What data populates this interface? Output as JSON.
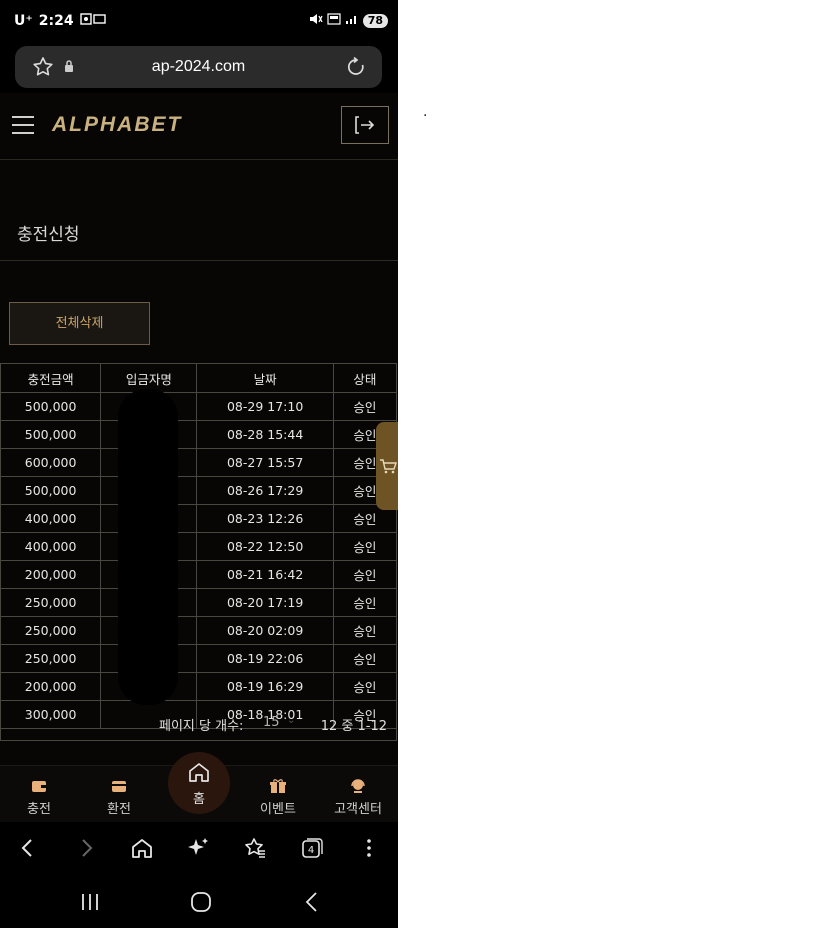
{
  "status_bar": {
    "carrier": "U⁺",
    "time": "2:24",
    "battery": "78"
  },
  "browser": {
    "url": "ap-2024.com",
    "tab_count": "4"
  },
  "site": {
    "logo": "ALPHABET",
    "page_title": "충전신청",
    "delete_all_label": "전체삭제"
  },
  "table": {
    "headers": [
      "충전금액",
      "입금자명",
      "날짜",
      "상태"
    ],
    "rows": [
      {
        "amount": "500,000",
        "name": "",
        "date": "08-29 17:10",
        "status": "승인"
      },
      {
        "amount": "500,000",
        "name": "",
        "date": "08-28 15:44",
        "status": "승인"
      },
      {
        "amount": "600,000",
        "name": "",
        "date": "08-27 15:57",
        "status": "승인"
      },
      {
        "amount": "500,000",
        "name": "",
        "date": "08-26 17:29",
        "status": "승인"
      },
      {
        "amount": "400,000",
        "name": "",
        "date": "08-23 12:26",
        "status": "승인"
      },
      {
        "amount": "400,000",
        "name": "",
        "date": "08-22 12:50",
        "status": "승인"
      },
      {
        "amount": "200,000",
        "name": "",
        "date": "08-21 16:42",
        "status": "승인"
      },
      {
        "amount": "250,000",
        "name": "",
        "date": "08-20 17:19",
        "status": "승인"
      },
      {
        "amount": "250,000",
        "name": "",
        "date": "08-20 02:09",
        "status": "승인"
      },
      {
        "amount": "250,000",
        "name": "",
        "date": "08-19 22:06",
        "status": "승인"
      },
      {
        "amount": "200,000",
        "name": "",
        "date": "08-19 16:29",
        "status": "승인"
      },
      {
        "amount": "300,000",
        "name": "",
        "date": "08-18 18:01",
        "status": "승인"
      }
    ]
  },
  "pager": {
    "per_page_label": "페이지 당 개수:",
    "per_page_value": "15",
    "range_text": "12 중 1-12"
  },
  "bottom_nav": {
    "items": [
      {
        "label": "충전",
        "icon": "wallet-icon"
      },
      {
        "label": "환전",
        "icon": "card-icon"
      },
      {
        "label": "홈",
        "icon": "home-icon"
      },
      {
        "label": "이벤트",
        "icon": "gift-icon"
      },
      {
        "label": "고객센터",
        "icon": "support-icon"
      }
    ]
  },
  "other_text": ".",
  "colors": {
    "accent_gold": "#c9a46a",
    "background": "#070605",
    "border": "#4a4640"
  }
}
